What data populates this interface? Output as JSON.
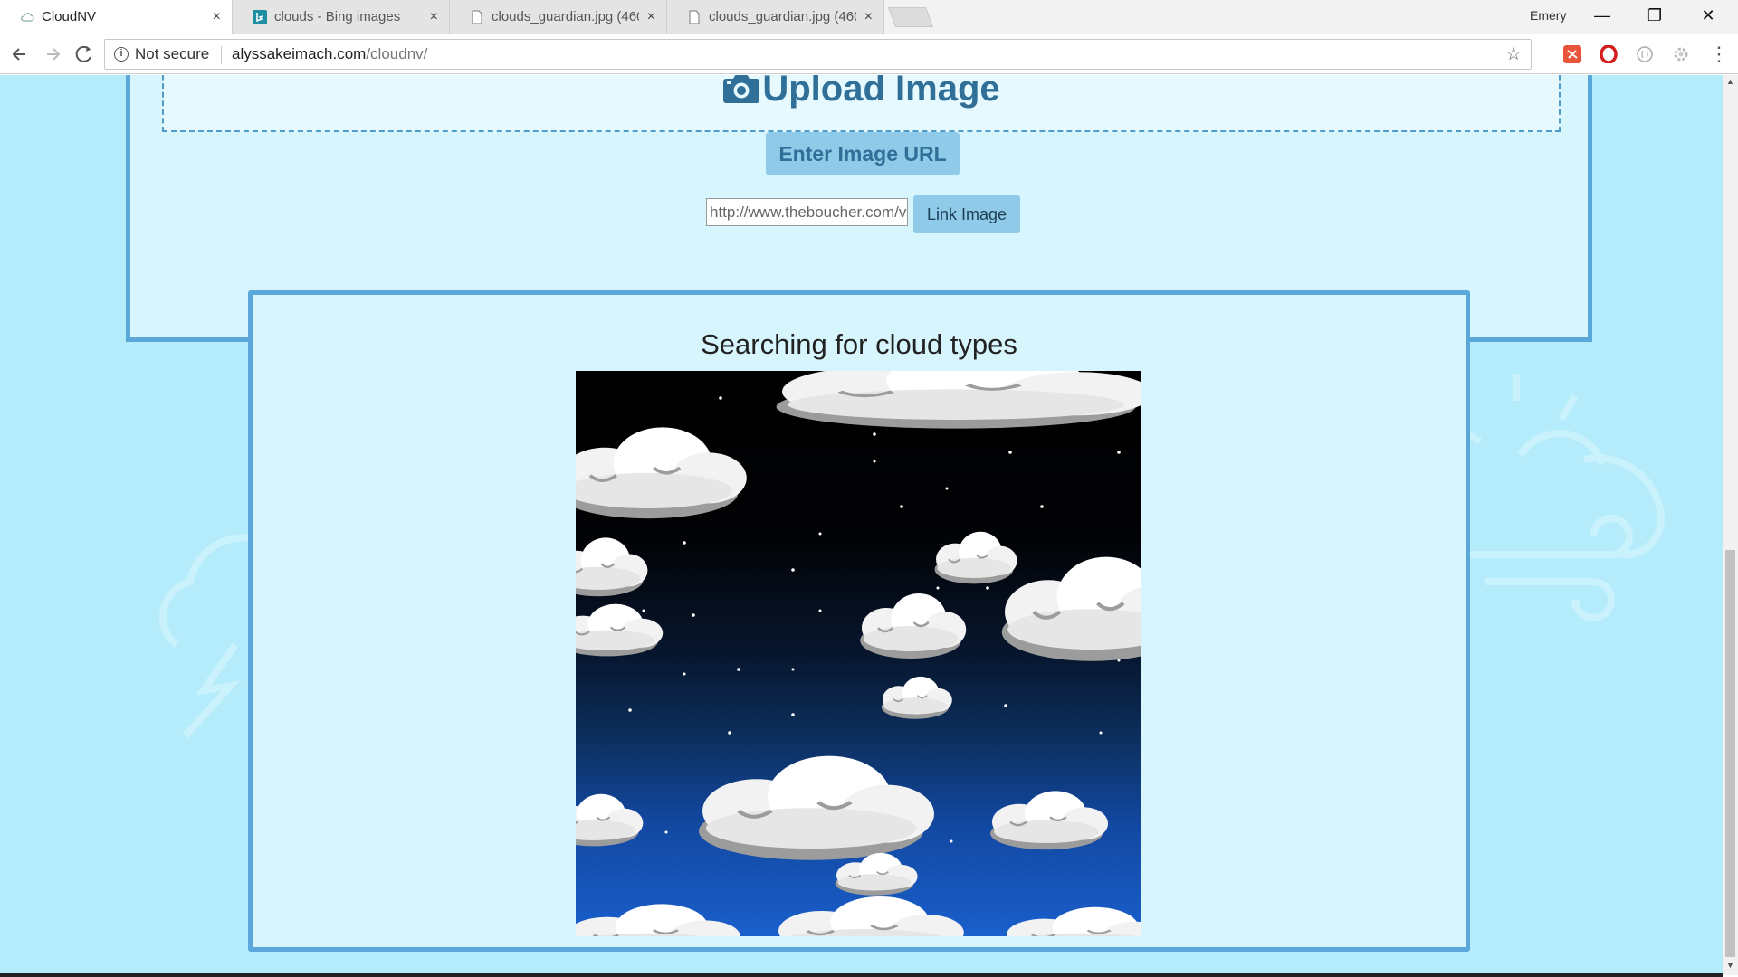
{
  "browser": {
    "tabs": [
      {
        "title": "CloudNV",
        "favicon": "cloud-favicon",
        "active": true
      },
      {
        "title": "clouds - Bing images",
        "favicon": "bing-favicon",
        "active": false
      },
      {
        "title": "clouds_guardian.jpg (460",
        "favicon": "file-favicon",
        "active": false
      },
      {
        "title": "clouds_guardian.jpg (460",
        "favicon": "file-favicon",
        "active": false
      }
    ],
    "close_glyph": "×",
    "profile_name": "Emery",
    "window_controls": {
      "minimize": "—",
      "restore": "❐",
      "close": "✕"
    },
    "security_label": "Not secure",
    "url_host": "alyssakeimach.com",
    "url_path": "/cloudnv/",
    "bookmark_glyph": "☆"
  },
  "page": {
    "upload": {
      "title": "Upload Image",
      "enter_url_label": "Enter Image URL",
      "url_input_value": "http://www.theboucher.com/v",
      "link_button_label": "Link Image"
    },
    "results": {
      "heading": "Searching for cloud types"
    }
  },
  "colors": {
    "page_background": "#b5ecfb",
    "panel_background": "#d6f5fd",
    "panel_border": "#5aa7d9",
    "title_color": "#2f6f98",
    "button_background": "#8fcbe8"
  }
}
